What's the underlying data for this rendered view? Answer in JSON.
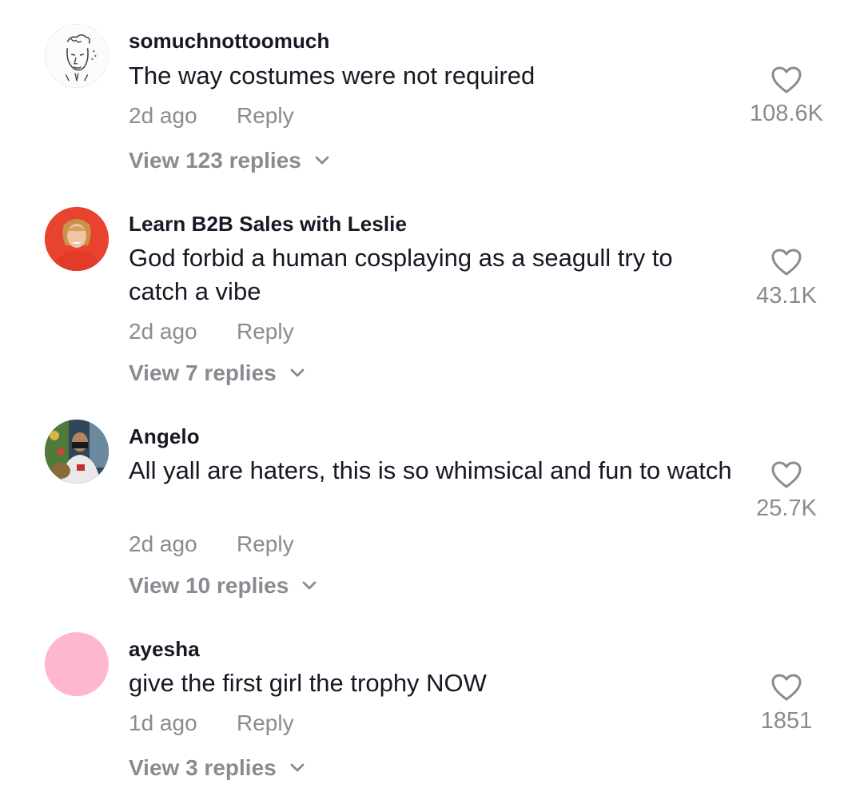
{
  "comments": [
    {
      "username": "somuchnottoomuch",
      "text": "The way costumes were not required",
      "time": "2d ago",
      "reply_label": "Reply",
      "likes": "108.6K",
      "view_replies": "View 123 replies",
      "avatar_icon": "sketch-face-avatar"
    },
    {
      "username": "Learn B2B Sales with Leslie",
      "text": "God forbid a human cosplaying as a seagull try to catch a vibe",
      "time": "2d ago",
      "reply_label": "Reply",
      "likes": "43.1K",
      "view_replies": "View 7 replies",
      "avatar_icon": "photo-avatar"
    },
    {
      "username": "Angelo",
      "text": "All yall are haters, this is so whimsical and fun to watch",
      "time": "2d ago",
      "reply_label": "Reply",
      "likes": "25.7K",
      "view_replies": "View 10 replies",
      "avatar_icon": "photo-avatar"
    },
    {
      "username": "ayesha",
      "text": "give the first girl the trophy NOW",
      "time": "1d ago",
      "reply_label": "Reply",
      "likes": "1851",
      "view_replies": "View 3 replies",
      "avatar_icon": "pink-circle-avatar"
    }
  ],
  "colors": {
    "text_primary": "#161823",
    "text_secondary": "#8a8b91",
    "avatar_pink": "#ffb6cf",
    "avatar_red": "#e8432e"
  }
}
